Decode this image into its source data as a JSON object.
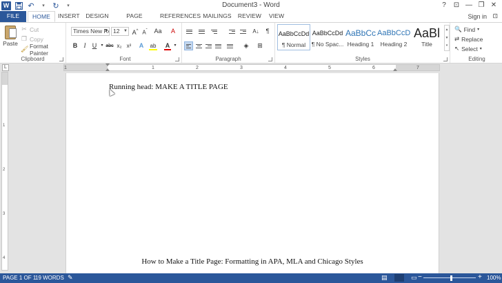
{
  "window": {
    "title": "Document3 - Word",
    "controls": [
      "?",
      "⊡",
      "—",
      "❐",
      "✕"
    ]
  },
  "quick_access": {
    "icons": [
      "word-logo-icon",
      "save-icon",
      "undo-icon",
      "redo-icon",
      "customize-icon"
    ]
  },
  "tabs": [
    "FILE",
    "HOME",
    "INSERT",
    "DESIGN",
    "PAGE LAYOUT",
    "REFERENCES",
    "MAILINGS",
    "REVIEW",
    "VIEW"
  ],
  "account": {
    "sign_in": "Sign in"
  },
  "clipboard": {
    "label": "Clipboard",
    "paste": "Paste",
    "cut": "Cut",
    "copy": "Copy",
    "format_painter": "Format Painter"
  },
  "font": {
    "label": "Font",
    "family": "Times New Ro",
    "size": "12",
    "grow": "A",
    "shrink": "A",
    "change_case": "Aa",
    "clear": "A",
    "bold": "B",
    "italic": "I",
    "underline": "U",
    "strike": "abc",
    "subscript": "x₂",
    "superscript": "x²",
    "effects": "A",
    "highlight": "ab",
    "color": "A",
    "colors": {
      "highlight": "#ffff00",
      "font_color": "#e00000"
    }
  },
  "paragraph": {
    "label": "Paragraph",
    "pilcrow": "¶",
    "sort": "A↓"
  },
  "styles": {
    "label": "Styles",
    "items": [
      {
        "preview": "AaBbCcDd",
        "name": "¶ Normal"
      },
      {
        "preview": "AaBbCcDd",
        "name": "¶ No Spac..."
      },
      {
        "preview": "AaBbCc",
        "name": "Heading 1"
      },
      {
        "preview": "AaBbCcD",
        "name": "Heading 2"
      },
      {
        "preview": "AaBl",
        "name": "Title"
      }
    ],
    "heading_color": "#2e74b5"
  },
  "editing": {
    "label": "Editing",
    "find": "Find",
    "replace": "Replace",
    "select": "Select"
  },
  "ruler": {
    "tab_selector": "L",
    "numbers": [
      "1",
      "1",
      "2",
      "3",
      "4",
      "5",
      "6",
      "7"
    ],
    "vertical_numbers": [
      "1",
      "2",
      "3",
      "4"
    ]
  },
  "document": {
    "header": "Running head: MAKE A TITLE PAGE",
    "title": "How to Make a Title Page: Formatting in APA, MLA and Chicago Styles"
  },
  "status": {
    "page": "PAGE 1 OF 1",
    "words": "19 WORDS",
    "zoom": "100%",
    "zoom_minus": "−",
    "zoom_plus": "+"
  },
  "colors": {
    "accent": "#2b579a",
    "page": "#ffffff",
    "workspace": "#e3e3e3"
  }
}
